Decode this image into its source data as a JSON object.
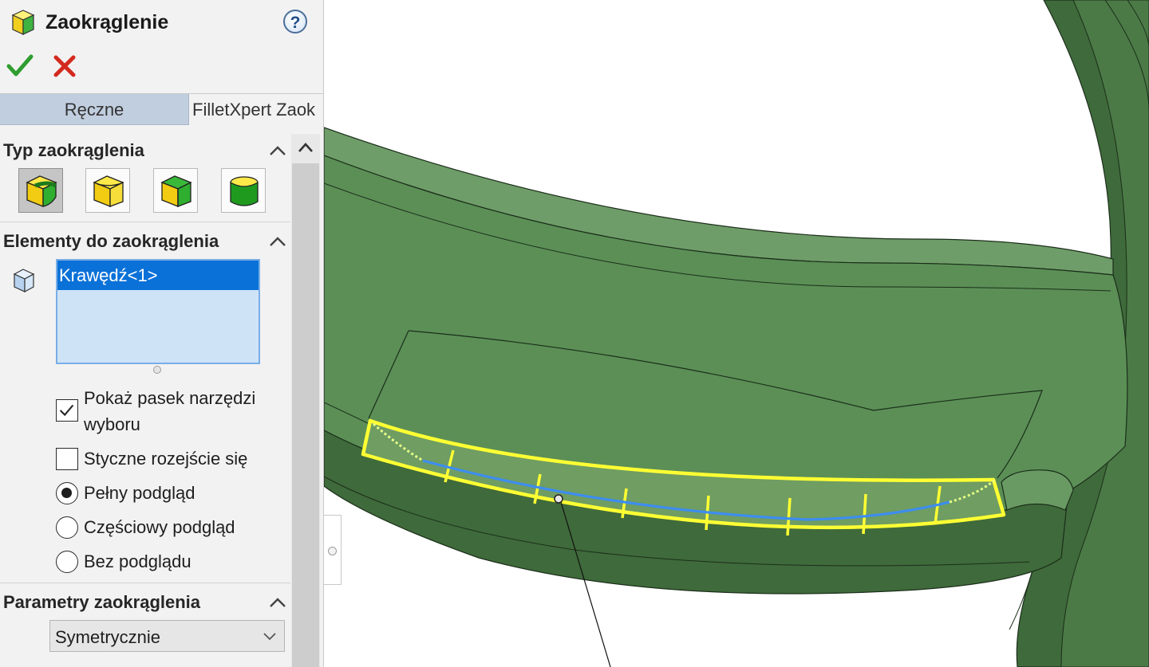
{
  "panel": {
    "title": "Zaokrąglenie",
    "help_label": "?",
    "icons": {
      "title": "fillet-feature-icon",
      "help": "help-icon",
      "ok": "checkmark-icon",
      "cancel": "close-icon"
    },
    "tabs": [
      {
        "label": "Ręczne",
        "active": true
      },
      {
        "label": "FilletXpert Zaok",
        "active": false
      }
    ],
    "fillet_type": {
      "title": "Typ zaokrąglenia",
      "buttons": [
        {
          "icon": "constant-size-fillet-icon",
          "active": true
        },
        {
          "icon": "variable-size-fillet-icon",
          "active": false
        },
        {
          "icon": "face-fillet-icon",
          "active": false
        },
        {
          "icon": "full-round-fillet-icon",
          "active": false
        }
      ]
    },
    "items": {
      "title": "Elementy do zaokrąglenia",
      "list_icon": "edge-select-icon",
      "selected": [
        "Krawędź<1>"
      ]
    },
    "options": {
      "show_toolbar": {
        "label_line1": "Pokaż pasek narzędzi",
        "label_line2": "wyboru",
        "checked": true
      },
      "tangent": {
        "label": "Styczne rozejście się",
        "checked": false
      },
      "full_preview": {
        "label": "Pełny podgląd",
        "selected": true
      },
      "partial_preview": {
        "label": "Częściowy podgląd",
        "selected": false
      },
      "no_preview": {
        "label": "Bez podglądu",
        "selected": false
      }
    },
    "params": {
      "title": "Parametry zaokrąglenia",
      "select_value": "Symetrycznie"
    }
  },
  "colors": {
    "panel_bg": "#f2f2f2",
    "tab_active": "#c1cedf",
    "list_bg": "#cfe3f7",
    "selection": "#0a71d8",
    "model_green": "#5b8f56",
    "model_dark": "#3f6a3b",
    "highlight_yellow": "#ffff33",
    "edge_blue": "#3d8df0"
  }
}
